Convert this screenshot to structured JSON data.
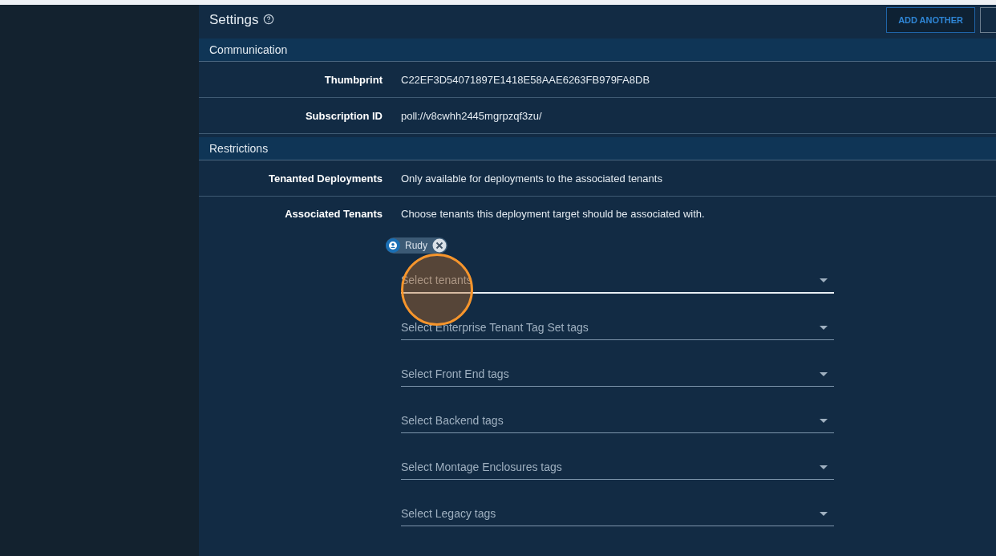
{
  "header": {
    "title": "Settings",
    "buttons": [
      "ADD ANOTHER"
    ]
  },
  "sections": [
    {
      "title": "Communication",
      "rows": [
        {
          "label": "Thumbprint",
          "value": "C22EF3D54071897E1418E58AAE6263FB979FA8DB"
        },
        {
          "label": "Subscription ID",
          "value": "poll://v8cwhh2445mgrpzqf3zu/"
        }
      ]
    },
    {
      "title": "Restrictions",
      "rows": [
        {
          "label": "Tenanted Deployments",
          "value": "Only available for deployments to the associated tenants"
        }
      ]
    }
  ],
  "tenants": {
    "label": "Associated Tenants",
    "description": "Choose tenants this deployment target should be associated with.",
    "chips": [
      {
        "label": "Rudy"
      }
    ],
    "fields": [
      {
        "placeholder": "Select tenants",
        "focused": true
      },
      {
        "placeholder": "Select Enterprise Tenant Tag Set tags",
        "focused": false
      },
      {
        "placeholder": "Select Front End tags",
        "focused": false
      },
      {
        "placeholder": "Select Backend tags",
        "focused": false
      },
      {
        "placeholder": "Select Montage Enclosures tags",
        "focused": false
      },
      {
        "placeholder": "Select Legacy tags",
        "focused": false
      }
    ]
  },
  "click_highlight": true
}
